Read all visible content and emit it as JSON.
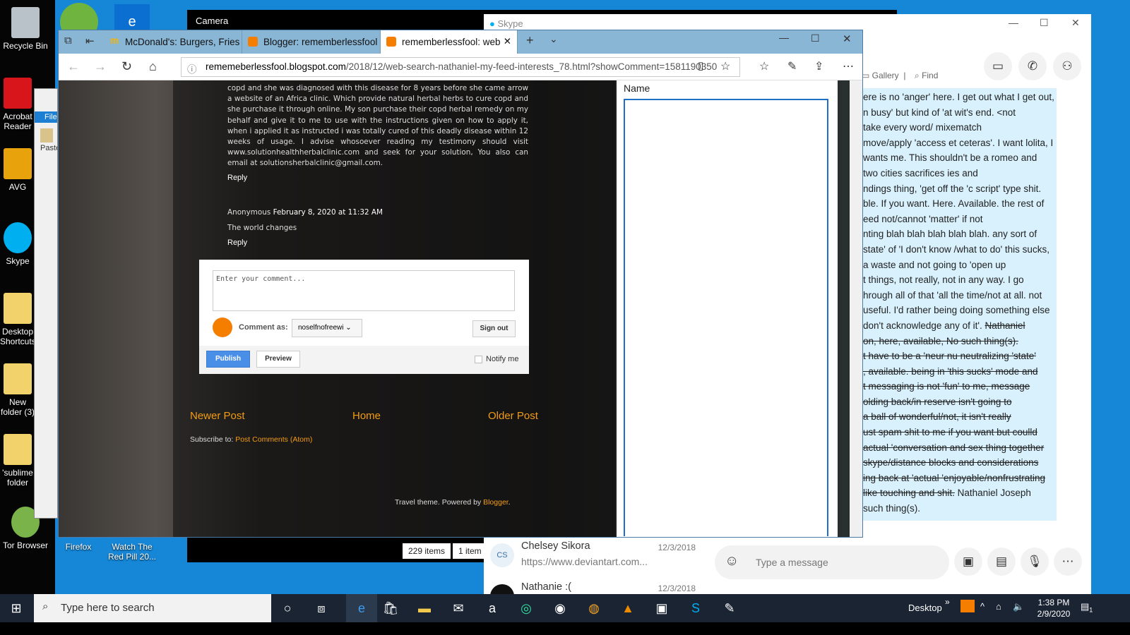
{
  "desktop": {
    "icons": [
      "Recycle Bin",
      "Acrobat Reader",
      "AVG",
      "Skype",
      "Desktop Shortcuts",
      "New folder (3)",
      "'sublime folder",
      "Tor Browser",
      "Firefox",
      "Watch The Red Pill 20..."
    ],
    "background_color": "#1686d6"
  },
  "camera": {
    "title": "Camera"
  },
  "explorer": {
    "menu": "File",
    "paste": "Paste",
    "status_items": "229 items",
    "status_selected": "1 item"
  },
  "edge": {
    "tabs": [
      {
        "label": "McDonald's: Burgers, Fries &"
      },
      {
        "label": "Blogger: rememberlessfool"
      },
      {
        "label": "rememberlessfool: web",
        "active": true
      }
    ],
    "url_host": "rememeberlessfool.blogspot.com",
    "url_path": "/2018/12/web-search-nathaniel-my-feed-interests_78.html?showComment=1581190350",
    "blog": {
      "comment_body": "copd and she was diagnosed with this disease for 8 years before she came arrow a website of an Africa clinic. Which provide natural herbal herbs to cure copd and she purchase it through online. My son purchase their copd herbal remedy on my behalf and give it to me to use with the instructions given on how to apply it, when i applied it as instructed i was totally cured of this deadly disease within 12 weeks of usage. I advise whosoever reading my testimony should visit www.solutionhealthherbalclinic.com and seek for your solution, You also can email at solutionsherbalclinic@gmail.com.",
      "reply": "Reply",
      "comment2_author": "Anonymous",
      "comment2_date": "February 8, 2020 at 11:32 AM",
      "comment2_body": "The world changes",
      "comment_placeholder": "Enter your comment...",
      "comment_as_label": "Comment as:",
      "comment_as_value": "noselfnofreewi",
      "sign_out": "Sign out",
      "publish": "Publish",
      "preview": "Preview",
      "notify": "Notify me",
      "newer": "Newer Post",
      "home": "Home",
      "older": "Older Post",
      "subscribe": "Subscribe to:",
      "subscribe_link": "Post Comments (Atom)",
      "footer": "Travel theme. Powered by",
      "footer_link": "Blogger",
      "accent": "#f39c12"
    },
    "side_panel": {
      "name_label": "Name"
    }
  },
  "skype": {
    "title": "Skype",
    "gallery": "Gallery",
    "find": "Find",
    "message_lines": [
      {
        "t": "ere is no 'anger' here. I get out what I get out,"
      },
      {
        "t": "n busy' but kind of 'at wit's end. <not"
      },
      {
        "t": "take every word/ mixematch"
      },
      {
        "t": "move/apply 'access et ceteras'. I want lolita, I"
      },
      {
        "t": "wants me. This shouldn't be a romeo and"
      },
      {
        "t": "two cities sacrifices ies and"
      },
      {
        "t": "ndings thing, 'get off the 'c script' type shit."
      },
      {
        "t": "ble. If you want. Here. Available. the rest of"
      },
      {
        "t": "eed not/cannot 'matter' if not"
      },
      {
        "t": "nting blah blah blah blah blah. any sort of"
      },
      {
        "t": "state' of 'I don't know /what to do' this sucks,"
      },
      {
        "t": "a waste and not going to 'open up"
      },
      {
        "t": "t things, not really, not in any way. I go"
      },
      {
        "t": "hrough all of that 'all the time/not at all. not"
      },
      {
        "t": "useful. I'd rather being doing something else"
      },
      {
        "t": "don't acknowledge any of it'. ",
        "s": "Nathaniel"
      },
      {
        "s": "on, here, available, No such thing(s)."
      },
      {
        "s": "t have to be a 'neur nu neutralizing 'state'"
      },
      {
        "s": ", available. being in 'this sucks' mode and"
      },
      {
        "s": "t messaging is not 'fun' to me, message"
      },
      {
        "s": "olding back/in reserve isn't going to"
      },
      {
        "s": "a ball of wonderful/not, it isn't really"
      },
      {
        "s": "ust spam shit to me if you want but coulld"
      },
      {
        "s": "actual 'conversation and sex thing together"
      },
      {
        "s": "skype/distance blocks and considerations"
      },
      {
        "s": "ing back at 'actual 'enjoyable/nonfrustrating"
      },
      {
        "s": "like touching and shit.",
        "t2": "Nathaniel Joseph"
      },
      {
        "t": "such thing(s)."
      }
    ],
    "chats": [
      {
        "initials": "CS",
        "name": "Chelsey Sikora",
        "date": "12/3/2018",
        "preview": "https://www.deviantart.com..."
      },
      {
        "initials": "",
        "name": "Nathanie :(",
        "date": "12/3/2018",
        "preview": ""
      }
    ],
    "compose_placeholder": "Type a message",
    "bubble_color": "#d8f1fd"
  },
  "taskbar": {
    "search_placeholder": "Type here to search",
    "desktop_label": "Desktop",
    "time": "1:38 PM",
    "date": "2/9/2020",
    "notification_count": "1"
  }
}
